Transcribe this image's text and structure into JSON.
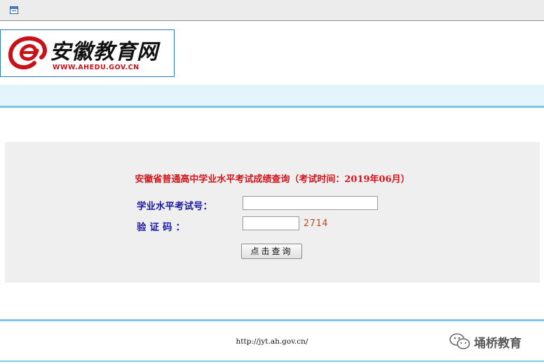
{
  "logo": {
    "title": "安徽教育网",
    "url": "WWW.AHEDU.GOV.CN",
    "accent_color": "#c8121a"
  },
  "form": {
    "title": "安徽省普通高中学业水平考试成绩查询（考试时间：2019年06月）",
    "exam_number_label": "学业水平考试号：",
    "exam_number_value": "",
    "captcha_label": "验证码：",
    "captcha_value": "",
    "captcha_code": "2714",
    "submit_label": "点击查询"
  },
  "footer": {
    "url": "http://jyt.ah.gov.cn/"
  },
  "watermark": {
    "text": "埇桥教育",
    "icon": "wechat-icon"
  },
  "colors": {
    "title_red": "#d4141b",
    "label_blue": "#1a1aa0",
    "band_blue": "#7ec4e4",
    "panel_gray": "#efefef"
  }
}
